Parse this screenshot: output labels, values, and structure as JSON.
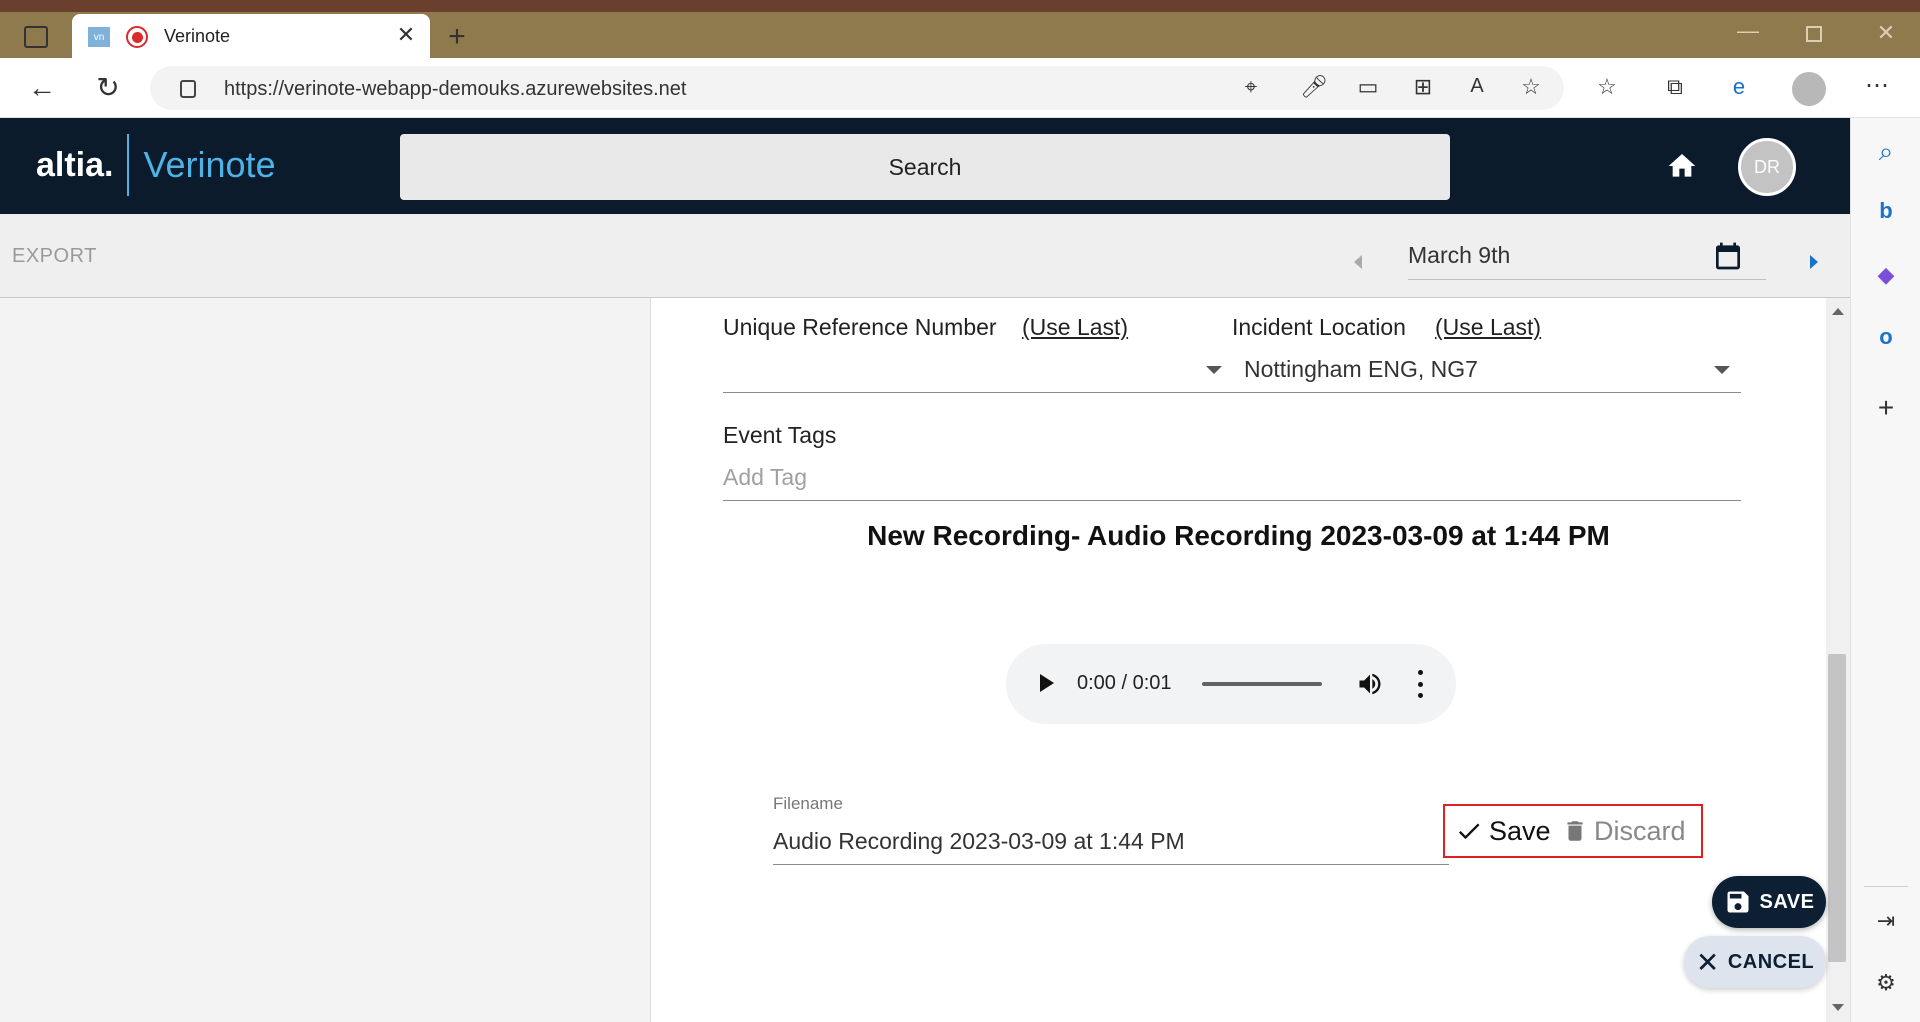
{
  "browser": {
    "tab_title": "Verinote",
    "tab_favicon": "vn",
    "url": "https://verinote-webapp-demouks.azurewebsites.net"
  },
  "app": {
    "brand_left": "altia.",
    "brand_right": "Verinote",
    "search_label": "Search",
    "avatar_initials": "DR"
  },
  "toolbar": {
    "export_label": "EXPORT",
    "date_value": "March 9th"
  },
  "form": {
    "urn_label": "Unique Reference Number",
    "urn_use_last": "(Use Last)",
    "location_label": "Incident Location",
    "location_use_last": "(Use Last)",
    "location_value": "Nottingham ENG, NG7",
    "event_tags_label": "Event Tags",
    "add_tag_placeholder": "Add Tag"
  },
  "recording": {
    "title": "New Recording- Audio Recording 2023-03-09 at 1:44 PM",
    "player_time": "0:00 / 0:01",
    "filename_label": "Filename",
    "filename_value": "Audio Recording 2023-03-09 at 1:44 PM",
    "save_label": "Save",
    "discard_label": "Discard"
  },
  "fabs": {
    "save_label": "SAVE",
    "cancel_label": "CANCEL"
  },
  "colors": {
    "header_bg": "#0b1b2c",
    "brand_accent": "#4fb3e6",
    "highlight": "#e02020",
    "fab_dark": "#0d2033"
  }
}
